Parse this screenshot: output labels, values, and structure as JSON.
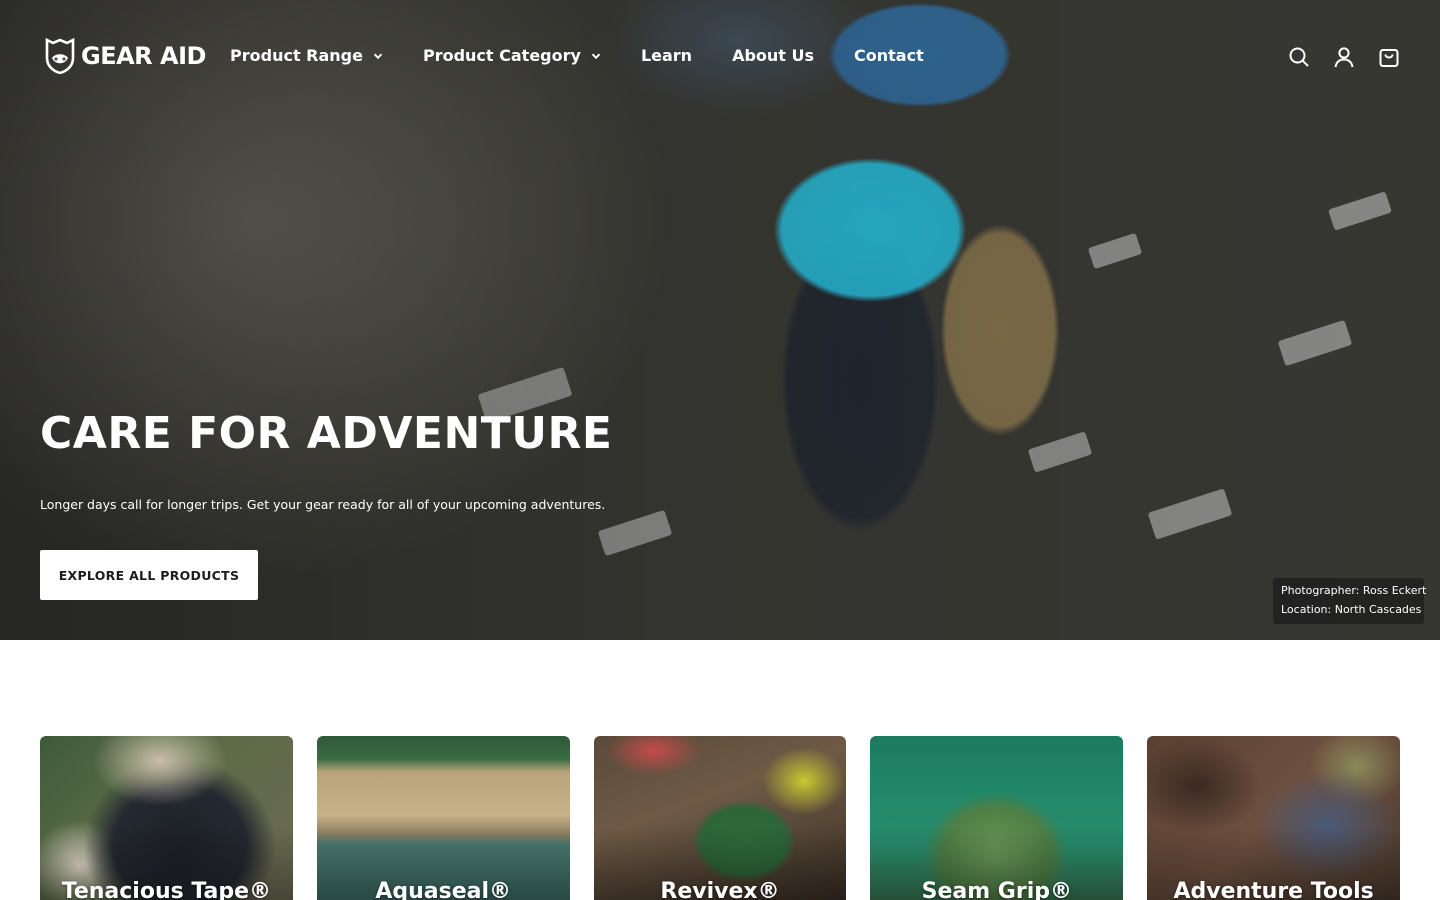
{
  "brand": {
    "name": "GEAR AID",
    "logo_icon": "gear-aid-shield-logo"
  },
  "nav": {
    "items": [
      {
        "label": "Product Range",
        "has_dropdown": true
      },
      {
        "label": "Product Category",
        "has_dropdown": true
      },
      {
        "label": "Learn",
        "has_dropdown": false
      },
      {
        "label": "About Us",
        "has_dropdown": false
      },
      {
        "label": "Contact",
        "has_dropdown": false
      }
    ]
  },
  "header_icons": [
    "search-icon",
    "account-icon",
    "cart-icon"
  ],
  "hero": {
    "title": "CARE FOR ADVENTURE",
    "subtitle": "Longer days call for longer trips. Get your gear ready for all of your upcoming adventures.",
    "cta_label": "EXPLORE ALL PRODUCTS",
    "credit": {
      "photographer": "Photographer: Ross Eckert",
      "location": "Location: North Cascades"
    }
  },
  "collections": [
    {
      "label": "Tenacious Tape®"
    },
    {
      "label": "Aquaseal®"
    },
    {
      "label": "Revivex®"
    },
    {
      "label": "Seam Grip®"
    },
    {
      "label": "Adventure Tools"
    }
  ],
  "colors": {
    "hero_text": "#ffffff",
    "button_bg": "#ffffff",
    "button_text": "#1c1c1c",
    "page_bg": "#ffffff"
  }
}
